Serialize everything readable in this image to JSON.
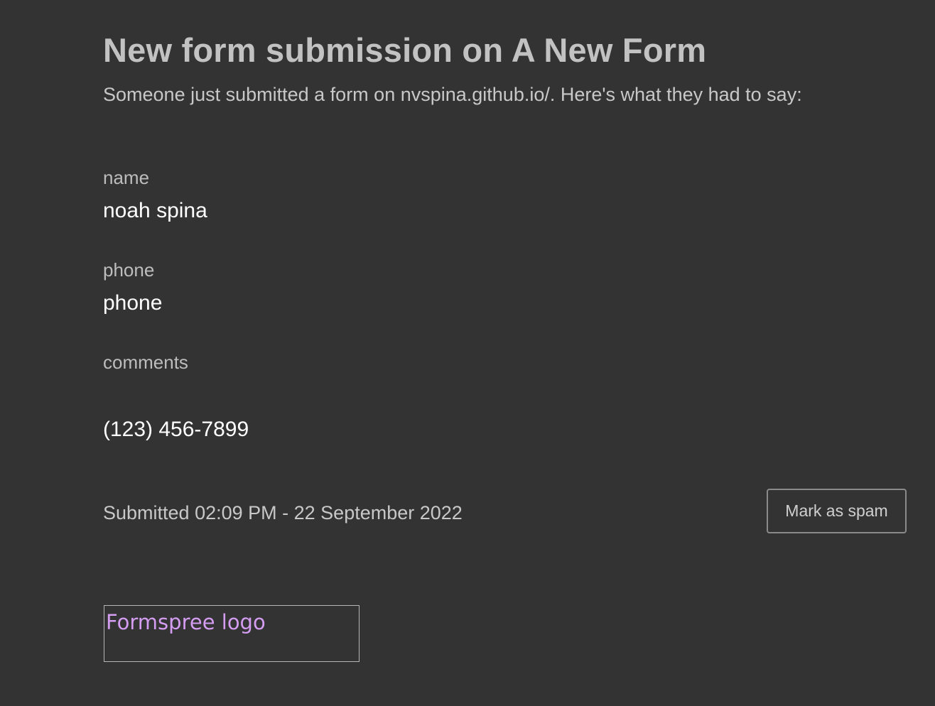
{
  "email": {
    "title": "New form submission on A New Form",
    "intro": "Someone just submitted a form on nvspina.github.io/. Here's what they had to say:",
    "fields": [
      {
        "label": "name",
        "value": "noah spina"
      },
      {
        "label": "phone",
        "value": "phone"
      },
      {
        "label": "comments",
        "value": "(123) 456-7899"
      }
    ],
    "submitted": "Submitted 02:09 PM - 22 September 2022",
    "spam_button": "Mark as spam",
    "logo_alt": "Formspree logo"
  },
  "colors": {
    "background": "#333333",
    "title": "#c2c2c2",
    "value": "#ffffff",
    "logo_alt_text": "#d49df2"
  }
}
